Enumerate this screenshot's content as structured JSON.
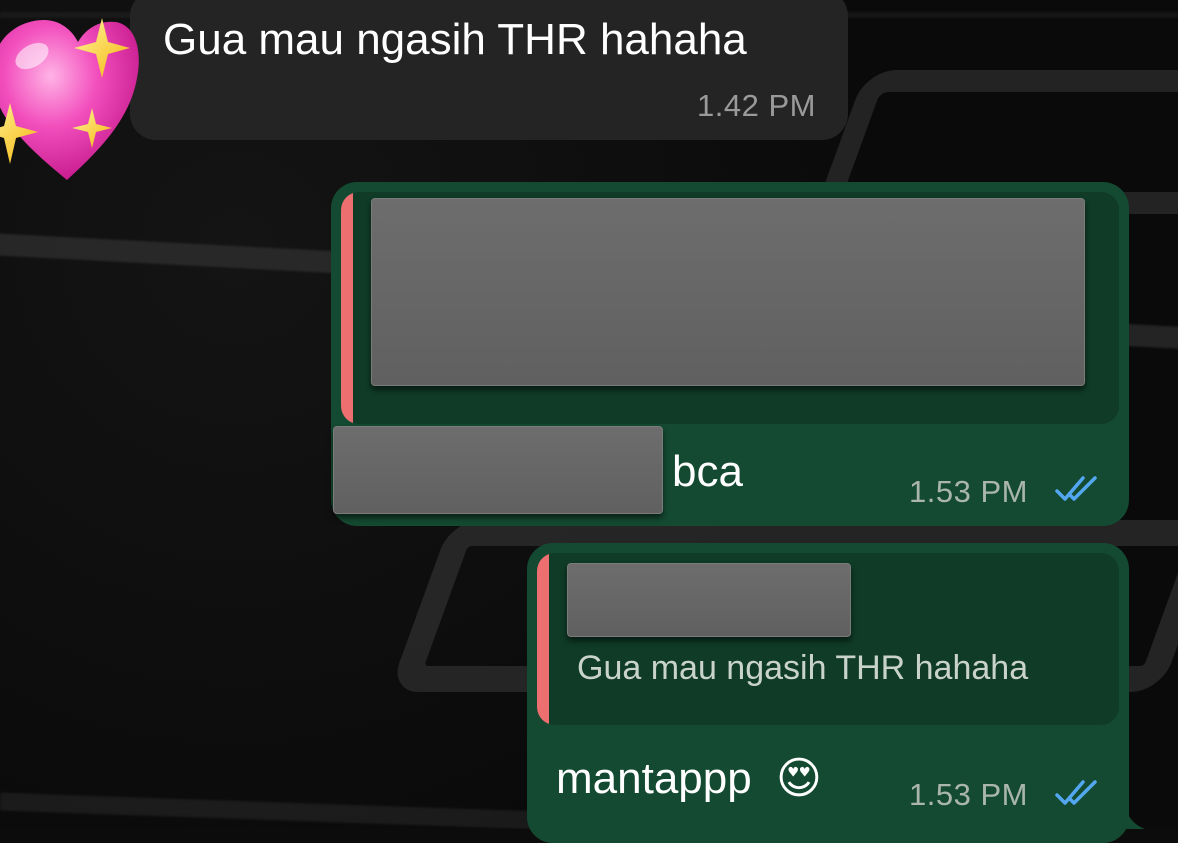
{
  "chat": {
    "messages": [
      {
        "direction": "incoming",
        "sticker": "sparkling-heart-emoji",
        "text": "Gua mau ngasih THR hahaha",
        "time": "1.42 PM"
      },
      {
        "direction": "outgoing",
        "quoted": "redacted",
        "redacted_prefix": true,
        "text": "bca",
        "time": "1.53 PM",
        "status": "read"
      },
      {
        "direction": "outgoing",
        "quoted_text": "Gua mau ngasih THR hahaha",
        "text": "mantappp",
        "emoji": "😍",
        "time": "1.53 PM",
        "status": "read"
      }
    ]
  },
  "colors": {
    "incoming_bubble": "#242424",
    "outgoing_bubble": "#144a31",
    "quote_bar": "#ee6f6f",
    "read_ticks": "#53a7f0"
  }
}
